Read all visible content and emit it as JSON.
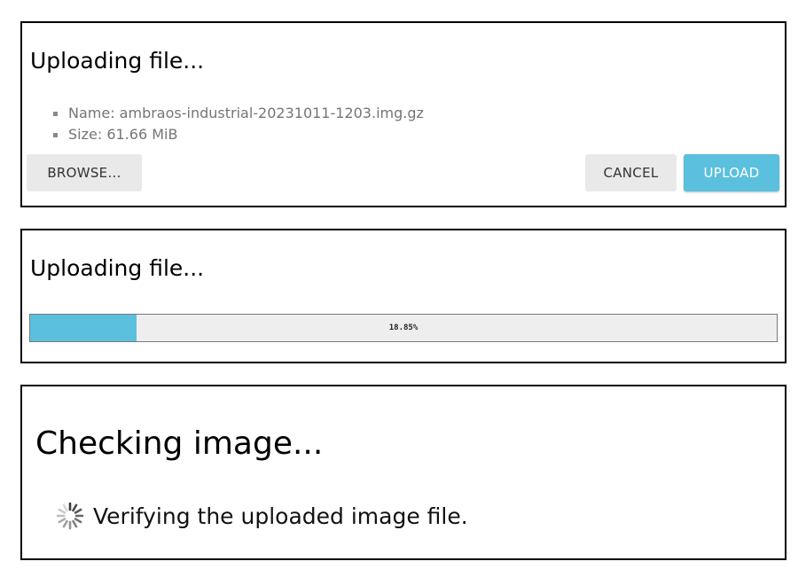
{
  "upload_dialog": {
    "title": "Uploading file...",
    "file_info": [
      "Name: ambraos-industrial-20231011-1203.img.gz",
      "Size: 61.66 MiB"
    ],
    "browse_label": "BROWSE...",
    "cancel_label": "CANCEL",
    "upload_label": "UPLOAD",
    "accent_color": "#5bc0de"
  },
  "progress_dialog": {
    "title": "Uploading file...",
    "progress_label": "18.85%",
    "progress_fraction": 0.143,
    "bar_color": "#5bc0de"
  },
  "checking_dialog": {
    "title": "Checking image...",
    "status_icon": "spinner-icon",
    "status_text": "Verifying the uploaded image file."
  }
}
